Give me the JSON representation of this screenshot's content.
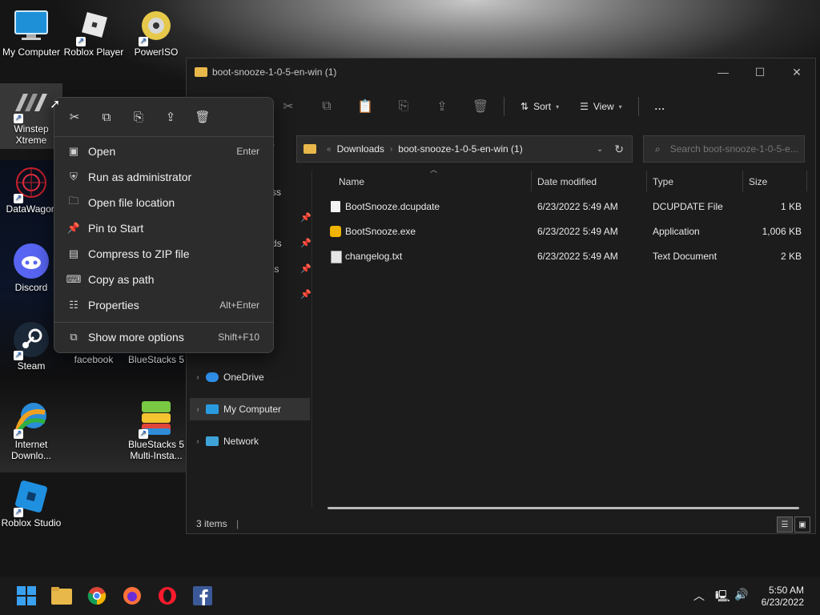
{
  "desktop": {
    "icons": [
      {
        "label": "My Computer",
        "icon": "monitor-icon"
      },
      {
        "label": "Roblox Player",
        "icon": "roblox-icon"
      },
      {
        "label": "PowerISO",
        "icon": "disc-icon"
      },
      {
        "label": "Winstep Xtreme",
        "icon": "winstep-icon"
      },
      {
        "label": "DataWagon",
        "icon": "datawagon-icon"
      },
      {
        "label": "Discord",
        "icon": "discord-icon"
      },
      {
        "label": "Steam",
        "icon": "steam-icon"
      },
      {
        "label": "facebook",
        "icon": "facebook-icon"
      },
      {
        "label": "BlueStacks 5",
        "icon": "bluestacks-icon"
      },
      {
        "label": "Internet Downlo...",
        "icon": "idm-icon"
      },
      {
        "label": "BlueStacks 5 Multi-Insta...",
        "icon": "bluestacks-multi-icon"
      },
      {
        "label": "Roblox Studio",
        "icon": "roblox-studio-icon"
      }
    ]
  },
  "explorer": {
    "title": "boot-snooze-1-0-5-en-win (1)",
    "toolbar": {
      "sort_label": "Sort",
      "view_label": "View",
      "more_label": "..."
    },
    "address": {
      "crumbs": [
        "Downloads",
        "boot-snooze-1-0-5-en-win (1)"
      ]
    },
    "search": {
      "placeholder": "Search boot-snooze-1-0-5-e..."
    },
    "nav": {
      "partial_labels": [
        "ss",
        "ds",
        "ts"
      ],
      "items": [
        {
          "label": "OneDrive",
          "icon": "onedrive-icon"
        },
        {
          "label": "My Computer",
          "icon": "monitor-icon"
        },
        {
          "label": "Network",
          "icon": "network-icon"
        }
      ]
    },
    "columns": {
      "name": "Name",
      "date": "Date modified",
      "type": "Type",
      "size": "Size"
    },
    "files": [
      {
        "name": "BootSnooze.dcupdate",
        "date": "6/23/2022 5:49 AM",
        "type": "DCUPDATE File",
        "size": "1 KB",
        "icon": "file-icon"
      },
      {
        "name": "BootSnooze.exe",
        "date": "6/23/2022 5:49 AM",
        "type": "Application",
        "size": "1,006 KB",
        "icon": "app-icon"
      },
      {
        "name": "changelog.txt",
        "date": "6/23/2022 5:49 AM",
        "type": "Text Document",
        "size": "2 KB",
        "icon": "text-file-icon"
      }
    ],
    "status": "3 items"
  },
  "context_menu": {
    "items": [
      {
        "label": "Open",
        "shortcut": "Enter"
      },
      {
        "label": "Run as administrator",
        "shortcut": ""
      },
      {
        "label": "Open file location",
        "shortcut": ""
      },
      {
        "label": "Pin to Start",
        "shortcut": ""
      },
      {
        "label": "Compress to ZIP file",
        "shortcut": ""
      },
      {
        "label": "Copy as path",
        "shortcut": ""
      },
      {
        "label": "Properties",
        "shortcut": "Alt+Enter"
      },
      {
        "label": "Show more options",
        "shortcut": "Shift+F10"
      }
    ]
  },
  "taskbar": {
    "time": "5:50 AM",
    "date": "6/23/2022"
  },
  "colors": {
    "folder": "#e8b84a",
    "accent": "#1a5fc8"
  }
}
